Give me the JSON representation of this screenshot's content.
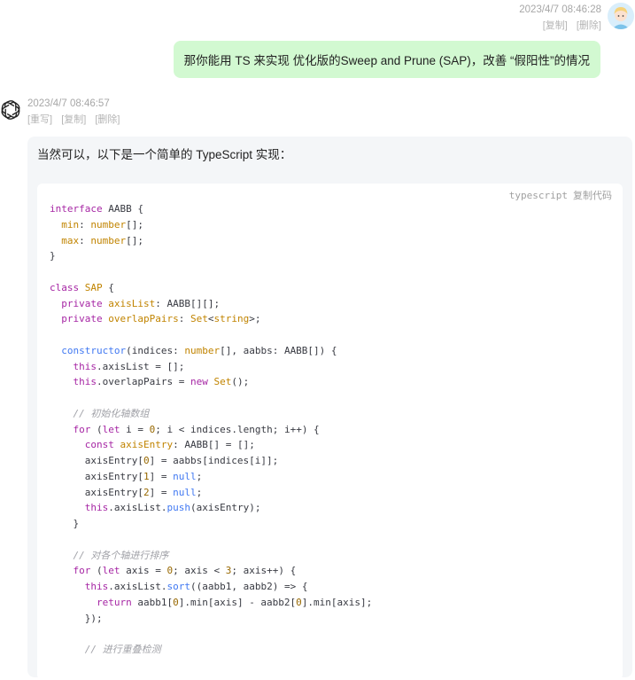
{
  "user_message": {
    "timestamp": "2023/4/7 08:46:28",
    "actions": [
      "[复制]",
      "[删除]"
    ],
    "text": "那你能用 TS 来实现  优化版的Sweep and Prune (SAP)，改善 “假阳性”的情况"
  },
  "bot_message": {
    "timestamp": "2023/4/7 08:46:57",
    "actions": [
      "[重写]",
      "[复制]",
      "[删除]"
    ],
    "intro": "当然可以，以下是一个简单的 TypeScript 实现：",
    "code_language": "typescript",
    "copy_code_label": "复制代码",
    "code_lines": [
      [
        [
          "kw",
          "interface"
        ],
        [
          "p",
          " AABB {"
        ]
      ],
      [
        [
          "p",
          "  "
        ],
        [
          "ty",
          "min"
        ],
        [
          "p",
          ": "
        ],
        [
          "ty",
          "number"
        ],
        [
          "p",
          "[];"
        ]
      ],
      [
        [
          "p",
          "  "
        ],
        [
          "ty",
          "max"
        ],
        [
          "p",
          ": "
        ],
        [
          "ty",
          "number"
        ],
        [
          "p",
          "[];"
        ]
      ],
      [
        [
          "p",
          "}"
        ]
      ],
      [],
      [
        [
          "kw",
          "class"
        ],
        [
          "p",
          " "
        ],
        [
          "ty",
          "SAP"
        ],
        [
          "p",
          " {"
        ]
      ],
      [
        [
          "p",
          "  "
        ],
        [
          "kw",
          "private"
        ],
        [
          "p",
          " "
        ],
        [
          "ty",
          "axisList"
        ],
        [
          "p",
          ": AABB[][];"
        ]
      ],
      [
        [
          "p",
          "  "
        ],
        [
          "kw",
          "private"
        ],
        [
          "p",
          " "
        ],
        [
          "ty",
          "overlapPairs"
        ],
        [
          "p",
          ": "
        ],
        [
          "ty",
          "Set"
        ],
        [
          "p",
          "<"
        ],
        [
          "ty",
          "string"
        ],
        [
          "p",
          ">;"
        ]
      ],
      [],
      [
        [
          "p",
          "  "
        ],
        [
          "lit",
          "constructor"
        ],
        [
          "p",
          "(indices: "
        ],
        [
          "ty",
          "number"
        ],
        [
          "p",
          "[], aabbs: AABB[]) {"
        ]
      ],
      [
        [
          "p",
          "    "
        ],
        [
          "kw",
          "this"
        ],
        [
          "p",
          ".axisList = [];"
        ]
      ],
      [
        [
          "p",
          "    "
        ],
        [
          "kw",
          "this"
        ],
        [
          "p",
          ".overlapPairs = "
        ],
        [
          "kw",
          "new"
        ],
        [
          "p",
          " "
        ],
        [
          "ty",
          "Set"
        ],
        [
          "p",
          "();"
        ]
      ],
      [],
      [
        [
          "cm",
          "    // 初始化轴数组"
        ]
      ],
      [
        [
          "p",
          "    "
        ],
        [
          "kw",
          "for"
        ],
        [
          "p",
          " ("
        ],
        [
          "kw",
          "let"
        ],
        [
          "p",
          " i = "
        ],
        [
          "num",
          "0"
        ],
        [
          "p",
          "; i < indices.length; i++) {"
        ]
      ],
      [
        [
          "p",
          "      "
        ],
        [
          "kw",
          "const"
        ],
        [
          "p",
          " "
        ],
        [
          "ty",
          "axisEntry"
        ],
        [
          "p",
          ": AABB[] = [];"
        ]
      ],
      [
        [
          "p",
          "      axisEntry["
        ],
        [
          "num",
          "0"
        ],
        [
          "p",
          "] = aabbs[indices[i]];"
        ]
      ],
      [
        [
          "p",
          "      axisEntry["
        ],
        [
          "num",
          "1"
        ],
        [
          "p",
          "] = "
        ],
        [
          "lit",
          "null"
        ],
        [
          "p",
          ";"
        ]
      ],
      [
        [
          "p",
          "      axisEntry["
        ],
        [
          "num",
          "2"
        ],
        [
          "p",
          "] = "
        ],
        [
          "lit",
          "null"
        ],
        [
          "p",
          ";"
        ]
      ],
      [
        [
          "p",
          "      "
        ],
        [
          "kw",
          "this"
        ],
        [
          "p",
          ".axisList."
        ],
        [
          "lit",
          "push"
        ],
        [
          "p",
          "(axisEntry);"
        ]
      ],
      [
        [
          "p",
          "    }"
        ]
      ],
      [],
      [
        [
          "cm",
          "    // 对各个轴进行排序"
        ]
      ],
      [
        [
          "p",
          "    "
        ],
        [
          "kw",
          "for"
        ],
        [
          "p",
          " ("
        ],
        [
          "kw",
          "let"
        ],
        [
          "p",
          " axis = "
        ],
        [
          "num",
          "0"
        ],
        [
          "p",
          "; axis < "
        ],
        [
          "num",
          "3"
        ],
        [
          "p",
          "; axis++) {"
        ]
      ],
      [
        [
          "p",
          "      "
        ],
        [
          "kw",
          "this"
        ],
        [
          "p",
          ".axisList."
        ],
        [
          "lit",
          "sort"
        ],
        [
          "p",
          "((aabb1, aabb2) => {"
        ]
      ],
      [
        [
          "p",
          "        "
        ],
        [
          "kw",
          "return"
        ],
        [
          "p",
          " aabb1["
        ],
        [
          "num",
          "0"
        ],
        [
          "p",
          "].min[axis] - aabb2["
        ],
        [
          "num",
          "0"
        ],
        [
          "p",
          "].min[axis];"
        ]
      ],
      [
        [
          "p",
          "      });"
        ]
      ],
      [],
      [
        [
          "cm",
          "      // 进行重叠检测"
        ]
      ]
    ]
  }
}
